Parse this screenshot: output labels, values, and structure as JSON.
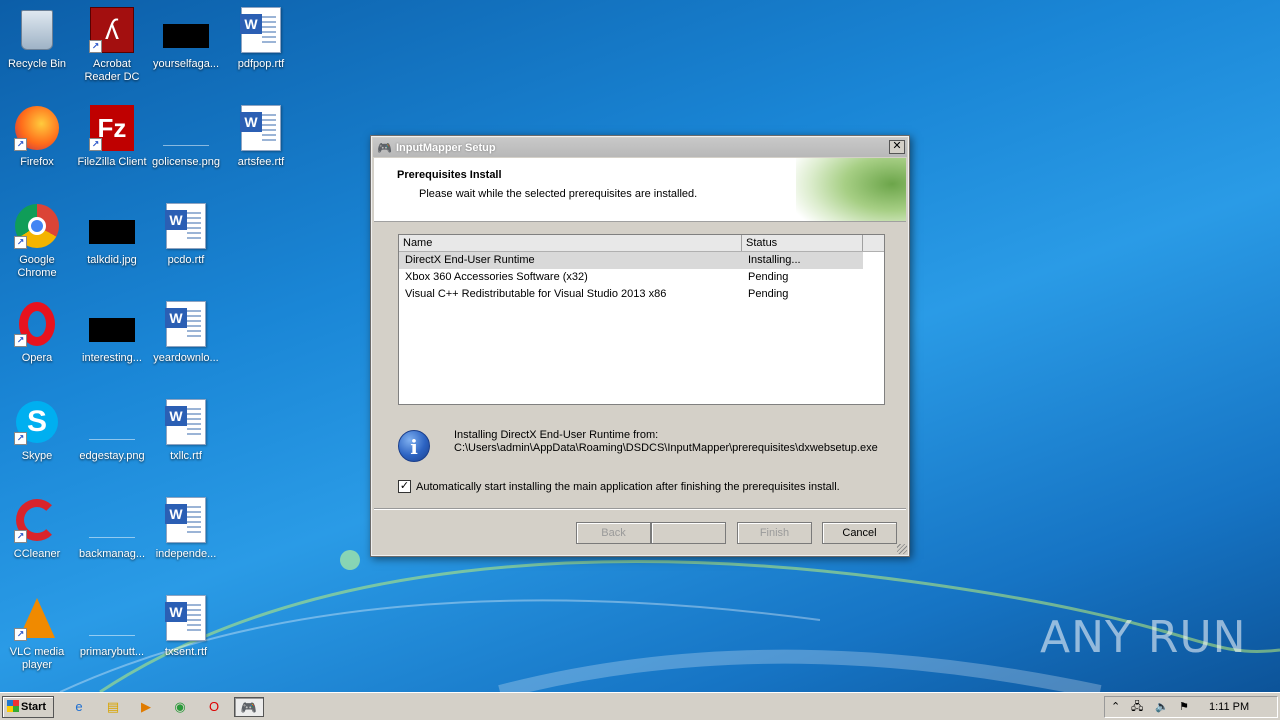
{
  "desktop": {
    "icons": [
      {
        "label": "Recycle Bin",
        "icon": "recycle-bin-icon"
      },
      {
        "label": "Acrobat Reader DC",
        "icon": "acrobat-icon"
      },
      {
        "label": "yourselfaga...",
        "icon": "image-thumbnail"
      },
      {
        "label": "pdfpop.rtf",
        "icon": "word-document-icon"
      },
      {
        "label": "Firefox",
        "icon": "firefox-icon"
      },
      {
        "label": "FileZilla Client",
        "icon": "filezilla-icon"
      },
      {
        "label": "golicense.png",
        "icon": "image-thumbnail"
      },
      {
        "label": "artsfee.rtf",
        "icon": "word-document-icon"
      },
      {
        "label": "Google Chrome",
        "icon": "chrome-icon"
      },
      {
        "label": "talkdid.jpg",
        "icon": "image-thumbnail"
      },
      {
        "label": "pcdo.rtf",
        "icon": "word-document-icon"
      },
      {
        "label": "Opera",
        "icon": "opera-icon"
      },
      {
        "label": "interesting...",
        "icon": "image-thumbnail"
      },
      {
        "label": "yeardownlo...",
        "icon": "word-document-icon"
      },
      {
        "label": "Skype",
        "icon": "skype-icon"
      },
      {
        "label": "edgestay.png",
        "icon": "image-thumbnail"
      },
      {
        "label": "txllc.rtf",
        "icon": "word-document-icon"
      },
      {
        "label": "CCleaner",
        "icon": "ccleaner-icon"
      },
      {
        "label": "backmanag...",
        "icon": "image-thumbnail"
      },
      {
        "label": "independe...",
        "icon": "word-document-icon"
      },
      {
        "label": "VLC media player",
        "icon": "vlc-icon"
      },
      {
        "label": "primarybutt...",
        "icon": "image-thumbnail"
      },
      {
        "label": "txsent.rtf",
        "icon": "word-document-icon"
      }
    ]
  },
  "dialog": {
    "title": "InputMapper Setup",
    "close_glyph": "✕",
    "header_title": "Prerequisites Install",
    "header_subtitle": "Please wait while the selected prerequisites are installed.",
    "columns": {
      "name": "Name",
      "status": "Status"
    },
    "rows": [
      {
        "name": "DirectX End-User Runtime",
        "status": "Installing..."
      },
      {
        "name": "Xbox 360 Accessories Software (x32)",
        "status": "Pending"
      },
      {
        "name": "Visual C++ Redistributable for Visual Studio 2013 x86",
        "status": "Pending"
      }
    ],
    "info_glyph": "i",
    "info_line1": "Installing DirectX End-User Runtime from:",
    "info_line2": "C:\\Users\\admin\\AppData\\Roaming\\DSDCS\\InputMapper\\prerequisites\\dxwebsetup.exe",
    "checkbox_checked": true,
    "checkbox_glyph": "✓",
    "checkbox_label": "Automatically start installing the main application after finishing the prerequisites install.",
    "buttons": {
      "back": "Back",
      "next": "",
      "finish": "Finish",
      "cancel": "Cancel"
    }
  },
  "taskbar": {
    "start_label": "Start",
    "clock": "1:11 PM"
  },
  "watermark": "ANY RUN"
}
